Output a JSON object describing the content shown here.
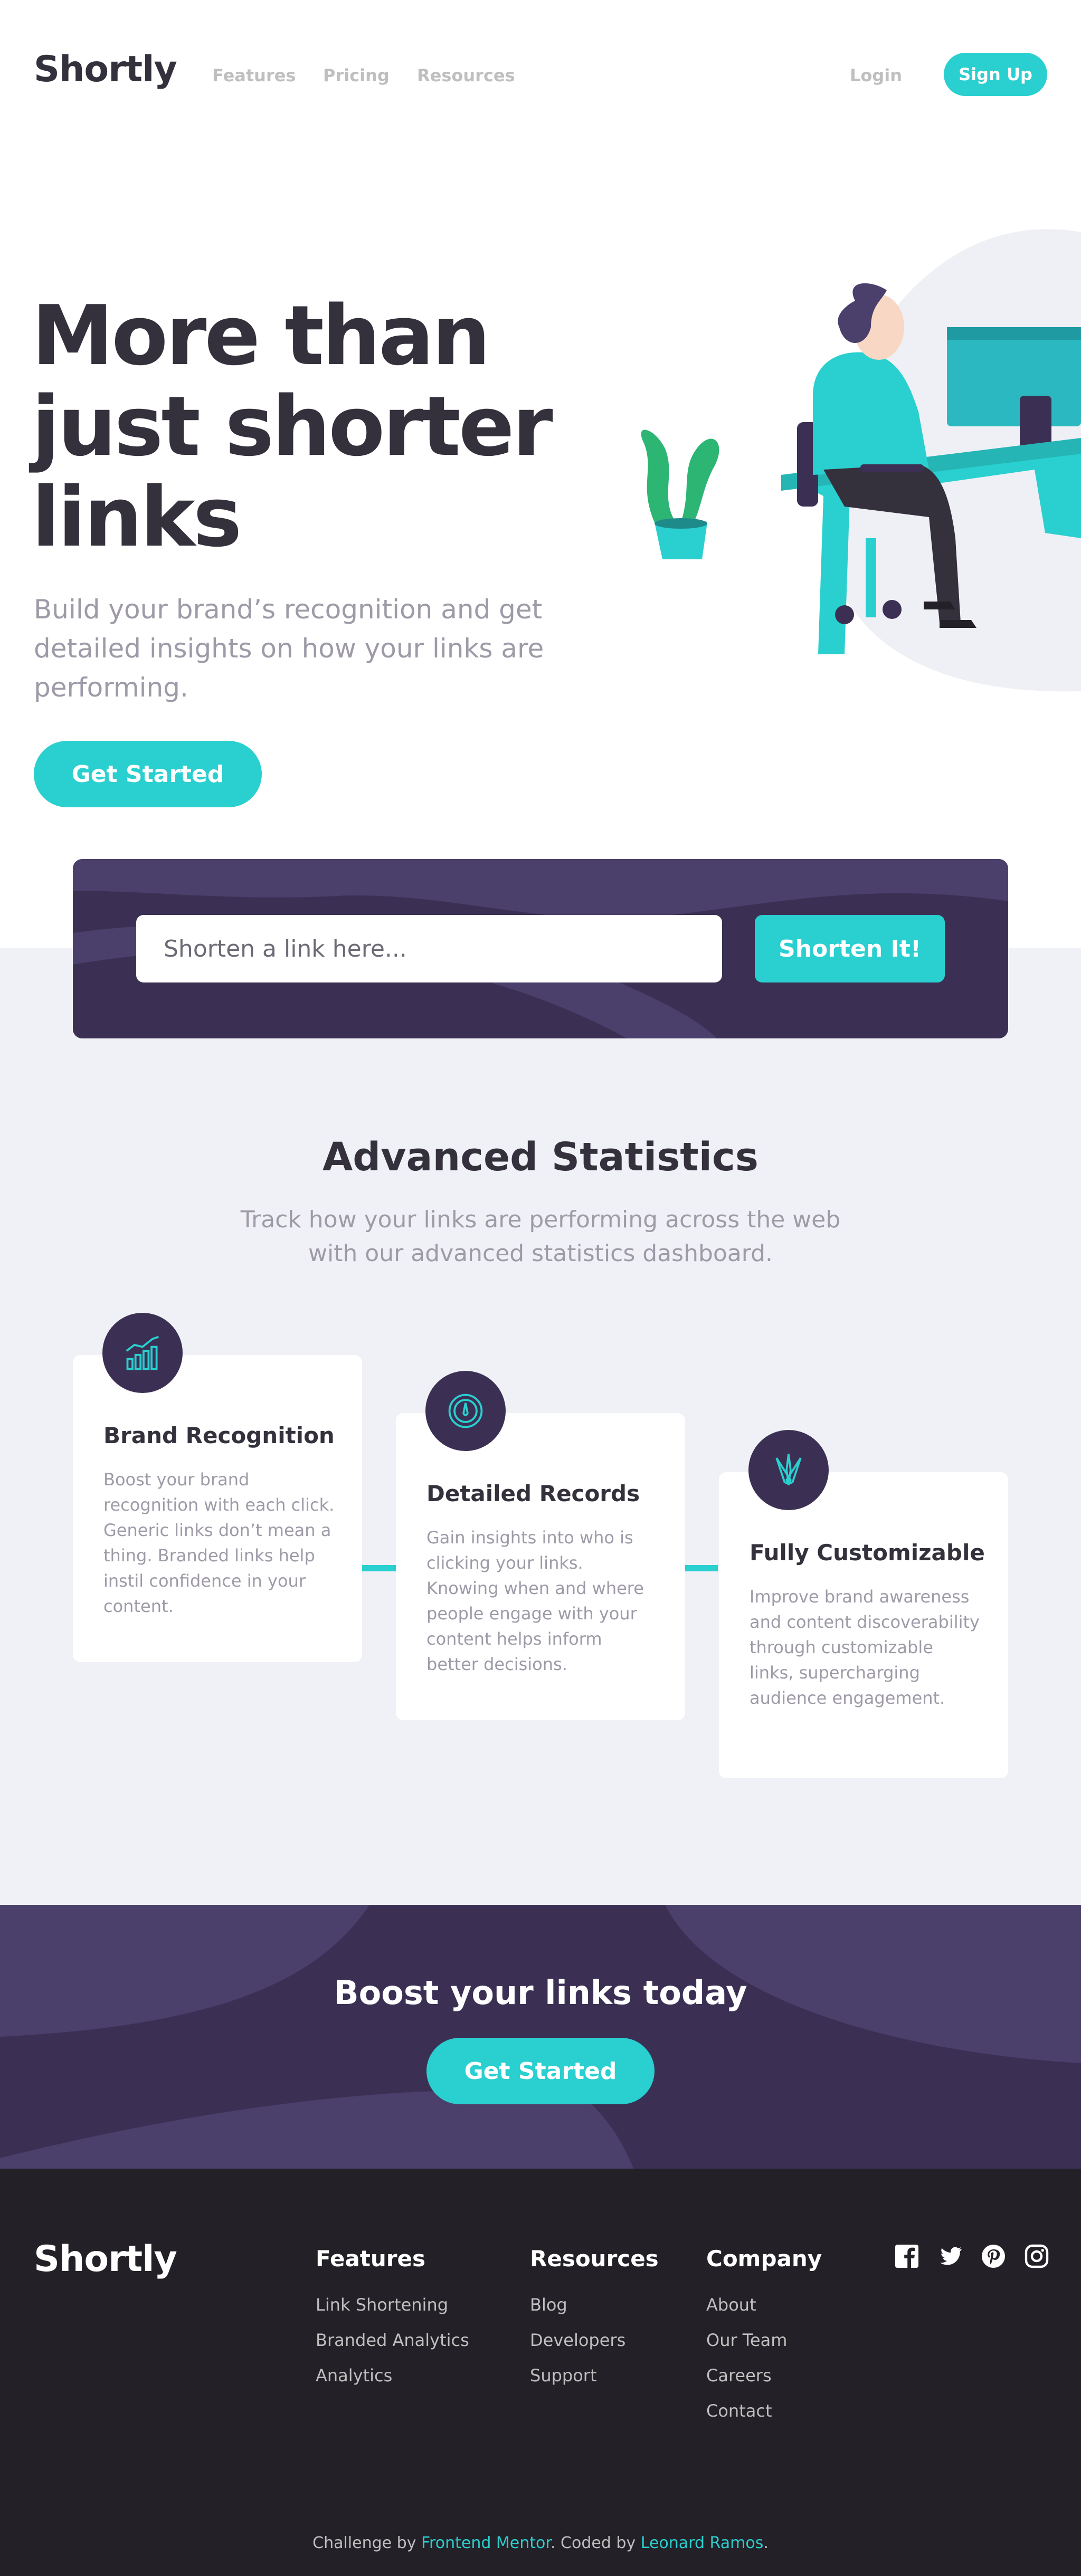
{
  "colors": {
    "accent": "#2acfcf",
    "dark_violet": "#3b3054",
    "very_dark_violet": "#232127",
    "gray_background": "#f0f1f6",
    "text_dark": "#34313d",
    "text_gray": "#9e9aa7"
  },
  "header": {
    "logo": "Shortly",
    "nav": [
      "Features",
      "Pricing",
      "Resources"
    ],
    "login": "Login",
    "signup": "Sign Up"
  },
  "hero": {
    "title": "More than just shorter links",
    "subtitle": "Build your brand’s recognition and get detailed insights on how your links are performing.",
    "cta": "Get Started"
  },
  "shorten": {
    "placeholder": "Shorten a link here...",
    "button": "Shorten It!"
  },
  "stats": {
    "title": "Advanced Statistics",
    "subtitle": "Track how your links are performing across the web with our advanced statistics dashboard.",
    "cards": [
      {
        "icon": "bar-chart-icon",
        "title": "Brand Recognition",
        "text": "Boost your brand recognition with each click. Generic links don’t mean a thing. Branded links help instil confidence in your content."
      },
      {
        "icon": "gauge-icon",
        "title": "Detailed Records",
        "text": "Gain insights into who is clicking your links. Knowing when and where people engage with your content helps inform better decisions."
      },
      {
        "icon": "pens-icon",
        "title": "Fully Customizable",
        "text": "Improve brand awareness and content discoverability through customizable links, supercharging audience engagement."
      }
    ]
  },
  "boost": {
    "title": "Boost your links today",
    "cta": "Get Started"
  },
  "footer": {
    "logo": "Shortly",
    "columns": [
      {
        "title": "Features",
        "links": [
          "Link Shortening",
          "Branded Analytics",
          "Analytics"
        ]
      },
      {
        "title": "Resources",
        "links": [
          "Blog",
          "Developers",
          "Support"
        ]
      },
      {
        "title": "Company",
        "links": [
          "About",
          "Our Team",
          "Careers",
          "Contact"
        ]
      }
    ],
    "socials": [
      "facebook-icon",
      "twitter-icon",
      "pinterest-icon",
      "instagram-icon"
    ],
    "attribution": {
      "prefix": "Challenge by ",
      "mentor": "Frontend Mentor",
      "middle": ". Coded by ",
      "author": "Leonard Ramos",
      "suffix": "."
    }
  }
}
